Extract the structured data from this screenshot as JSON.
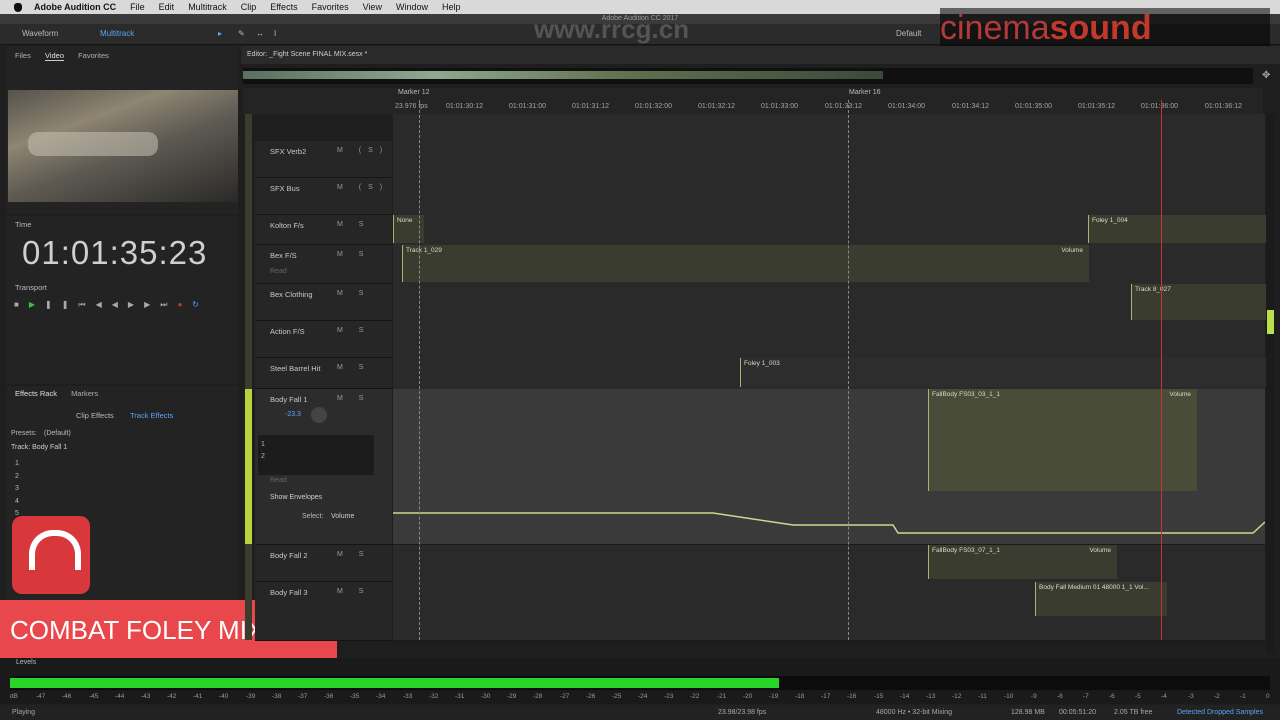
{
  "menubar": {
    "app": "Adobe Audition CC",
    "items": [
      "File",
      "Edit",
      "Multitrack",
      "Clip",
      "Effects",
      "Favorites",
      "View",
      "Window",
      "Help"
    ]
  },
  "window_title": "Adobe Audition CC 2017",
  "toolbar": {
    "waveform": "Waveform",
    "multitrack": "Multitrack",
    "workspace": "Default"
  },
  "watermark": {
    "site": "www.rrcg.cn",
    "brand_a": "cinema",
    "brand_b": "sound"
  },
  "left_tabs": {
    "files": "Files",
    "video": "Video",
    "favorites": "Favorites"
  },
  "time_panel": {
    "title": "Time",
    "timecode": "01:01:35:23"
  },
  "transport": {
    "title": "Transport"
  },
  "effects": {
    "tab1": "Effects Rack",
    "tab2": "Markers",
    "clip_effects": "Clip Effects",
    "track_effects": "Track Effects",
    "presets_label": "Presets:",
    "preset_value": "(Default)",
    "track_label": "Track: Body Fall 1",
    "slots": [
      "1",
      "2",
      "3",
      "4",
      "5"
    ]
  },
  "editor": {
    "title": "Editor: _Fight Scene FINAL MIX.sesx *",
    "fps": "23.976 fps",
    "marker12": "Marker 12",
    "marker16": "Marker 16",
    "ruler": [
      "01:01:30:12",
      "01:01:31:00",
      "01:01:31:12",
      "01:01:32:00",
      "01:01:32:12",
      "01:01:33:00",
      "01:01:33:12",
      "01:01:34:00",
      "01:01:34:12",
      "01:01:35:00",
      "01:01:35:12",
      "01:01:36:00",
      "01:01:36:12"
    ]
  },
  "tracks": [
    {
      "name": "SFX Verb2",
      "ms": "M (S)"
    },
    {
      "name": "SFX Bus",
      "ms": "M (S)"
    },
    {
      "name": "Kolton F/s",
      "ms": "M S"
    },
    {
      "name": "Bex F/S",
      "ms": "M S",
      "mode": "Read"
    },
    {
      "name": "Bex Clothing",
      "ms": "M S"
    },
    {
      "name": "Action F/S",
      "ms": "M S"
    },
    {
      "name": "Steel Barrel Hit",
      "ms": "M S"
    },
    {
      "name": "Body Fall 1",
      "ms": "M S",
      "volume": "-23.3"
    },
    {
      "name": "Body Fall 2",
      "ms": "M S"
    },
    {
      "name": "Body Fall 3",
      "ms": "M S"
    }
  ],
  "body_fall_1": {
    "fx_slots": [
      "1",
      "2"
    ],
    "mode": "Read",
    "show_envelopes": "Show Envelopes",
    "select_label": "Select:",
    "select_value": "Volume"
  },
  "clips": {
    "c1": "Foley 1_004",
    "c2": "Track 1_029",
    "c3": "Volume",
    "c4": "Track 8_027",
    "c5": "Foley 1_003",
    "c6": "FallBody FS03_03_1_1",
    "c7": "Volume",
    "c8": "FallBody FS03_07_1_1",
    "c9": "Volume",
    "c10": "Body Fall Medium 01 48000 1_1 Vol...",
    "c11": "None"
  },
  "overlay": {
    "title": "COMBAT FOLEY MIX"
  },
  "levels": {
    "title": "Levels",
    "scale": [
      "dB",
      "-47",
      "-46",
      "-45",
      "-44",
      "-43",
      "-42",
      "-41",
      "-40",
      "-39",
      "-38",
      "-37",
      "-36",
      "-35",
      "-34",
      "-33",
      "-32",
      "-31",
      "-30",
      "-29",
      "-28",
      "-27",
      "-26",
      "-25",
      "-24",
      "-23",
      "-22",
      "-21",
      "-20",
      "-19",
      "-18",
      "-17",
      "-16",
      "-15",
      "-14",
      "-13",
      "-12",
      "-11",
      "-10",
      "-9",
      "-8",
      "-7",
      "-6",
      "-5",
      "-4",
      "-3",
      "-2",
      "-1",
      "0"
    ],
    "level_fraction": 0.61
  },
  "statusbar": {
    "state": "Playing",
    "fps": "23.98/23.98 fps",
    "format": "48000 Hz • 32-bit Mixing",
    "mem": "128.98 MB",
    "duration": "00:05:51:20",
    "disk": "2.05 TB free",
    "warning": "Detected Dropped Samples"
  },
  "colors": {
    "accent": "#59a5f5",
    "clip": "#b0b070",
    "level": "#29d429",
    "overlay": "#e8474c"
  }
}
